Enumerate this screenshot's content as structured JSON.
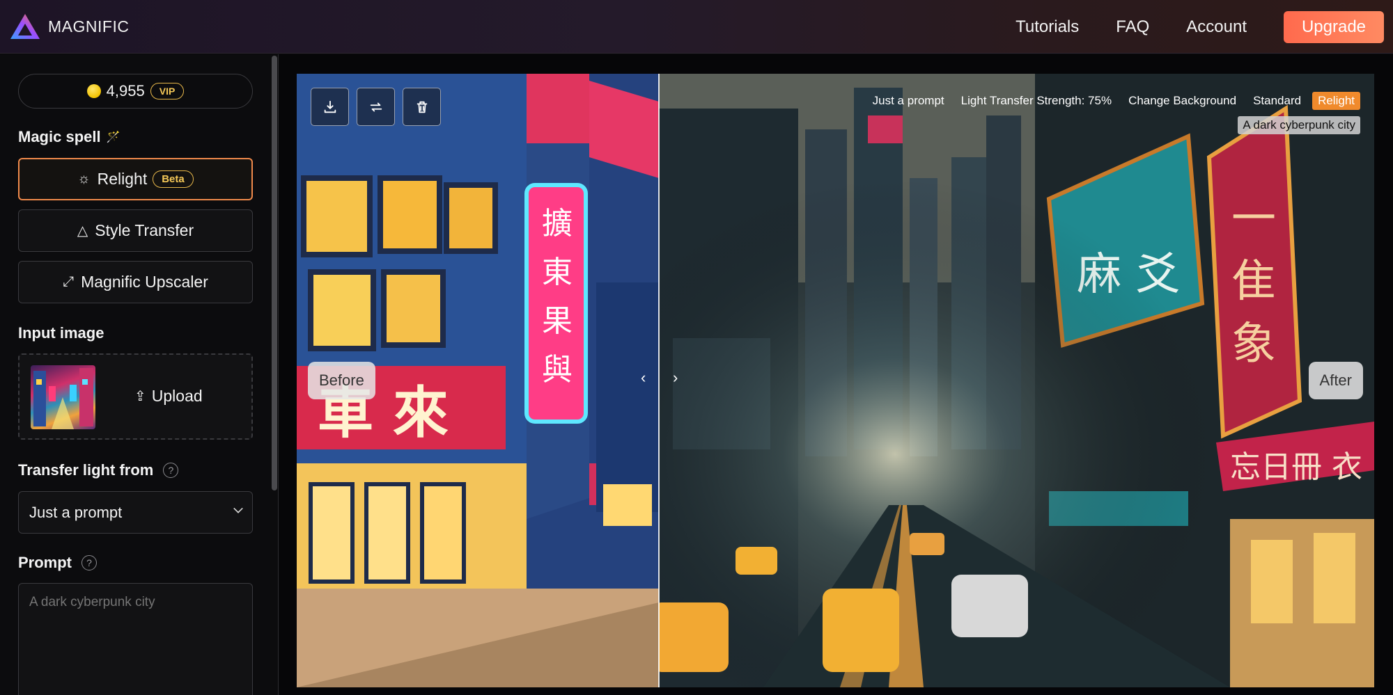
{
  "app": {
    "name": "MAGNIFIC"
  },
  "nav": {
    "tutorials": "Tutorials",
    "faq": "FAQ",
    "account": "Account",
    "upgrade": "Upgrade"
  },
  "credits": {
    "amount": "4,955",
    "tier": "VIP"
  },
  "magic_spell": {
    "title": "Magic spell",
    "options": [
      {
        "label": "Relight",
        "badge": "Beta",
        "icon": "sun-icon",
        "active": true
      },
      {
        "label": "Style Transfer",
        "icon": "triangle-icon",
        "active": false
      },
      {
        "label": "Magnific Upscaler",
        "icon": "expand-icon",
        "active": false
      }
    ]
  },
  "input_image": {
    "title": "Input image",
    "upload_label": "Upload"
  },
  "transfer_light": {
    "title": "Transfer light from",
    "selected": "Just a prompt"
  },
  "prompt": {
    "title": "Prompt",
    "placeholder": "A dark cyberpunk city"
  },
  "viewer": {
    "tags": [
      "Just a prompt",
      "Light Transfer Strength: 75%",
      "Change Background",
      "Standard",
      "Relight"
    ],
    "prompt_chip": "A dark cyberpunk city",
    "before_label": "Before",
    "after_label": "After",
    "split_fraction": 0.336
  },
  "colors": {
    "accent": "#f08a4b",
    "upgrade": "#ff7a58",
    "badge": "#f5c857",
    "relight_tag": "#f08a2c"
  }
}
